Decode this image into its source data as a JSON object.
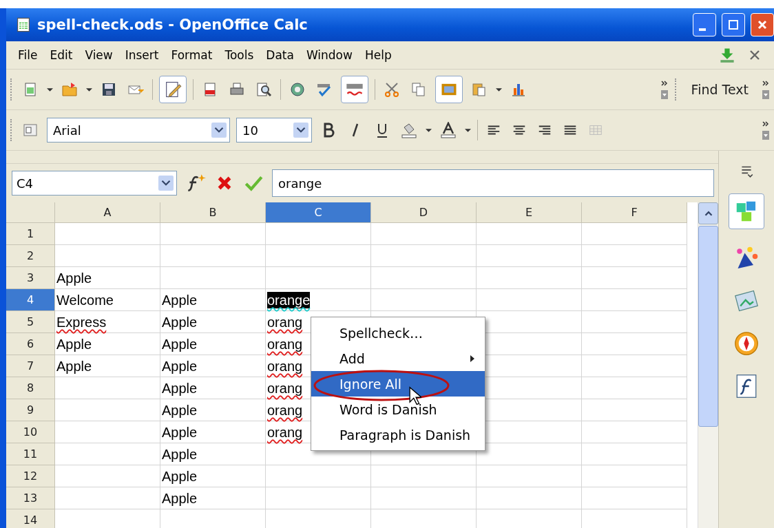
{
  "window": {
    "title": "spell-check.ods - OpenOffice Calc"
  },
  "menu_bar": [
    "File",
    "Edit",
    "View",
    "Insert",
    "Format",
    "Tools",
    "Data",
    "Window",
    "Help"
  ],
  "find_toolbar": {
    "label": "Find Text"
  },
  "formatting": {
    "font_name": "Arial",
    "font_size": "10"
  },
  "formula_bar": {
    "cell_reference": "C4",
    "content": "orange"
  },
  "sheet": {
    "columns": [
      {
        "label": "A",
        "selected": false
      },
      {
        "label": "B",
        "selected": false
      },
      {
        "label": "C",
        "selected": true
      },
      {
        "label": "D",
        "selected": false
      },
      {
        "label": "E",
        "selected": false
      },
      {
        "label": "F",
        "selected": false
      }
    ],
    "rows": [
      {
        "number": "1",
        "selected": false,
        "cells": [
          null,
          null,
          null,
          null,
          null,
          null
        ]
      },
      {
        "number": "2",
        "selected": false,
        "cells": [
          null,
          null,
          null,
          null,
          null,
          null
        ]
      },
      {
        "number": "3",
        "selected": false,
        "cells": [
          {
            "text": "Apple",
            "misspelled": false,
            "selected": false
          },
          null,
          null,
          null,
          null,
          null
        ]
      },
      {
        "number": "4",
        "selected": true,
        "cells": [
          {
            "text": "Welcome",
            "misspelled": false,
            "selected": false
          },
          {
            "text": "Apple",
            "misspelled": false,
            "selected": false
          },
          {
            "text": "orange",
            "misspelled": true,
            "selected": true
          },
          null,
          null,
          null
        ]
      },
      {
        "number": "5",
        "selected": false,
        "cells": [
          {
            "text": "Express",
            "misspelled": true,
            "selected": false
          },
          {
            "text": "Apple",
            "misspelled": false,
            "selected": false
          },
          {
            "text": "orang",
            "misspelled": true,
            "selected": false
          },
          null,
          null,
          null
        ]
      },
      {
        "number": "6",
        "selected": false,
        "cells": [
          {
            "text": "Apple",
            "misspelled": false,
            "selected": false
          },
          {
            "text": "Apple",
            "misspelled": false,
            "selected": false
          },
          {
            "text": "orang",
            "misspelled": true,
            "selected": false
          },
          null,
          null,
          null
        ]
      },
      {
        "number": "7",
        "selected": false,
        "cells": [
          {
            "text": "Apple",
            "misspelled": false,
            "selected": false
          },
          {
            "text": "Apple",
            "misspelled": false,
            "selected": false
          },
          {
            "text": "orang",
            "misspelled": true,
            "selected": false
          },
          null,
          null,
          null
        ]
      },
      {
        "number": "8",
        "selected": false,
        "cells": [
          null,
          {
            "text": "Apple",
            "misspelled": false,
            "selected": false
          },
          {
            "text": "orang",
            "misspelled": true,
            "selected": false
          },
          null,
          null,
          null
        ]
      },
      {
        "number": "9",
        "selected": false,
        "cells": [
          null,
          {
            "text": "Apple",
            "misspelled": false,
            "selected": false
          },
          {
            "text": "orang",
            "misspelled": true,
            "selected": false
          },
          null,
          null,
          null
        ]
      },
      {
        "number": "10",
        "selected": false,
        "cells": [
          null,
          {
            "text": "Apple",
            "misspelled": false,
            "selected": false
          },
          {
            "text": "orang",
            "misspelled": true,
            "selected": false
          },
          null,
          null,
          null
        ]
      },
      {
        "number": "11",
        "selected": false,
        "cells": [
          null,
          {
            "text": "Apple",
            "misspelled": false,
            "selected": false
          },
          null,
          null,
          null,
          null
        ]
      },
      {
        "number": "12",
        "selected": false,
        "cells": [
          null,
          {
            "text": "Apple",
            "misspelled": false,
            "selected": false
          },
          null,
          null,
          null,
          null
        ]
      },
      {
        "number": "13",
        "selected": false,
        "cells": [
          null,
          {
            "text": "Apple",
            "misspelled": false,
            "selected": false
          },
          null,
          null,
          null,
          null
        ]
      },
      {
        "number": "14",
        "selected": false,
        "cells": [
          null,
          null,
          null,
          null,
          null,
          null
        ]
      }
    ]
  },
  "context_menu": {
    "items": [
      {
        "label": "Spellcheck…",
        "selected": false,
        "submenu": false
      },
      {
        "label": "Add",
        "selected": false,
        "submenu": true
      },
      {
        "label": "Ignore All",
        "selected": true,
        "submenu": false
      },
      {
        "label": "Word is Danish",
        "selected": false,
        "submenu": false
      },
      {
        "label": "Paragraph is Danish",
        "selected": false,
        "submenu": false
      }
    ]
  }
}
